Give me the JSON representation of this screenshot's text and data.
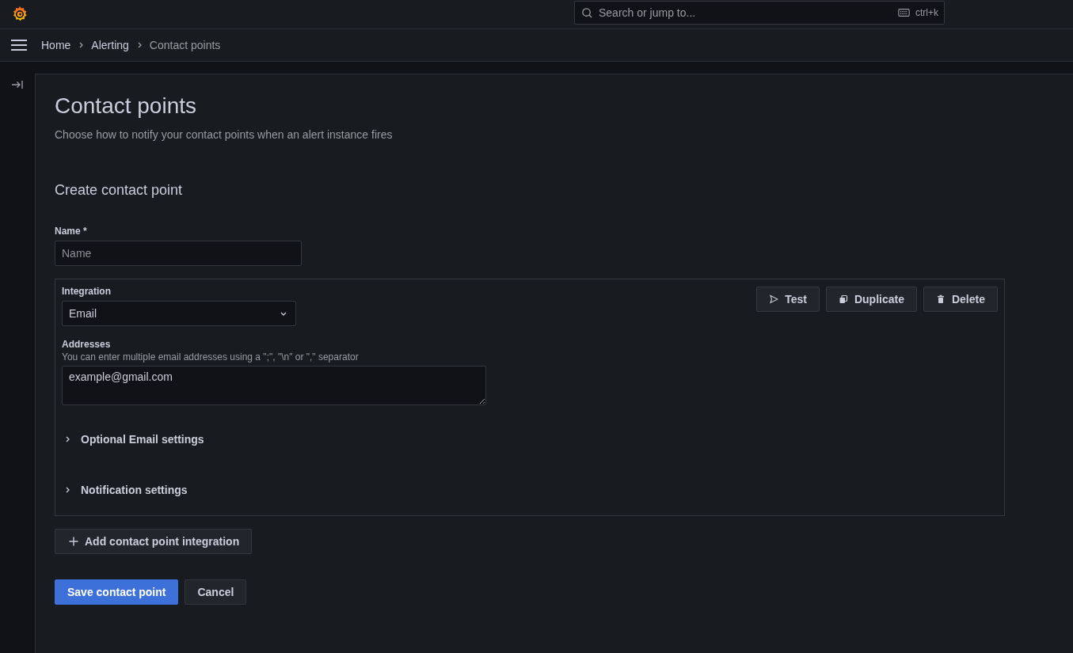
{
  "top_bar": {
    "search": {
      "placeholder": "Search or jump to...",
      "shortcut": "ctrl+k"
    }
  },
  "breadcrumbs": [
    {
      "label": "Home",
      "current": false
    },
    {
      "label": "Alerting",
      "current": false
    },
    {
      "label": "Contact points",
      "current": true
    }
  ],
  "page": {
    "title": "Contact points",
    "subtitle": "Choose how to notify your contact points when an alert instance fires"
  },
  "form": {
    "heading": "Create contact point",
    "name_field": {
      "label": "Name *",
      "placeholder": "Name"
    },
    "integration": {
      "label": "Integration",
      "value": "Email",
      "actions": [
        {
          "kind": "test",
          "label": "Test"
        },
        {
          "kind": "duplicate",
          "label": "Duplicate"
        },
        {
          "kind": "delete",
          "label": "Delete"
        }
      ],
      "addresses": {
        "label": "Addresses",
        "hint": "You can enter multiple email addresses using a \";\", \"\\n\" or \",\" separator",
        "value": "example@gmail.com"
      },
      "sections": [
        {
          "label": "Optional Email settings",
          "expanded": false
        },
        {
          "label": "Notification settings",
          "expanded": false
        }
      ]
    },
    "add_button": "Add contact point integration",
    "buttons": [
      {
        "kind": "primary",
        "label": "Save contact point"
      },
      {
        "kind": "secondary",
        "label": "Cancel"
      }
    ]
  }
}
